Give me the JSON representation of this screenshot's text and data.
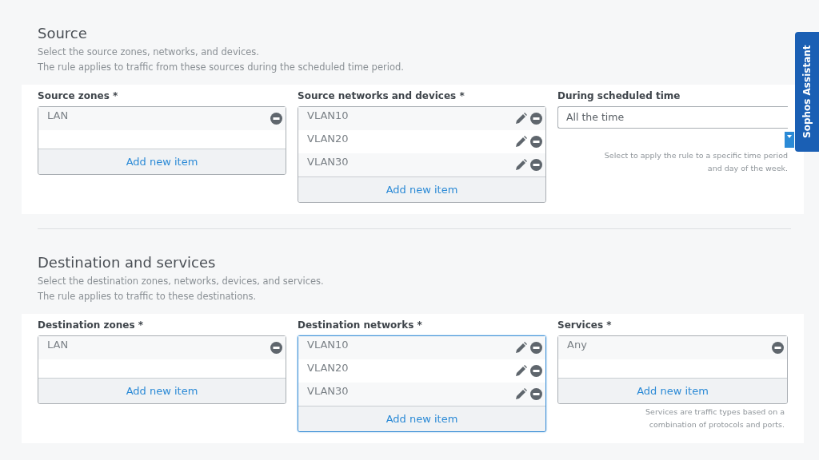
{
  "assistant_tab": {
    "label": "Sophos Assistant"
  },
  "sections": [
    {
      "title": "Source",
      "description": [
        "Select the source zones, networks, and devices.",
        "The rule applies to traffic from these sources during the scheduled time period."
      ],
      "fields": [
        {
          "kind": "list",
          "label": "Source zones *",
          "focused": false,
          "items": [
            {
              "label": "LAN",
              "editable": false
            }
          ],
          "add_label": "Add new item"
        },
        {
          "kind": "list",
          "label": "Source networks and devices *",
          "focused": false,
          "items": [
            {
              "label": "VLAN10",
              "editable": true
            },
            {
              "label": "VLAN20",
              "editable": true
            },
            {
              "label": "VLAN30",
              "editable": true
            }
          ],
          "add_label": "Add new item"
        },
        {
          "kind": "select",
          "label": "During scheduled time",
          "value": "All the time",
          "hint": "Select to apply the rule to a specific time period and day of the week."
        }
      ]
    },
    {
      "title": "Destination and services",
      "description": [
        "Select the destination zones, networks, devices, and services.",
        "The rule applies to traffic to these destinations."
      ],
      "fields": [
        {
          "kind": "list",
          "label": "Destination zones *",
          "focused": false,
          "items": [
            {
              "label": "LAN",
              "editable": false
            }
          ],
          "add_label": "Add new item"
        },
        {
          "kind": "list",
          "label": "Destination networks *",
          "focused": true,
          "items": [
            {
              "label": "VLAN10",
              "editable": true
            },
            {
              "label": "VLAN20",
              "editable": true
            },
            {
              "label": "VLAN30",
              "editable": true
            }
          ],
          "add_label": "Add new item"
        },
        {
          "kind": "list",
          "label": "Services *",
          "focused": false,
          "items": [
            {
              "label": "Any",
              "editable": false
            }
          ],
          "add_label": "Add new item",
          "hint": "Services are traffic types based on a combination of protocols and ports."
        }
      ]
    }
  ]
}
